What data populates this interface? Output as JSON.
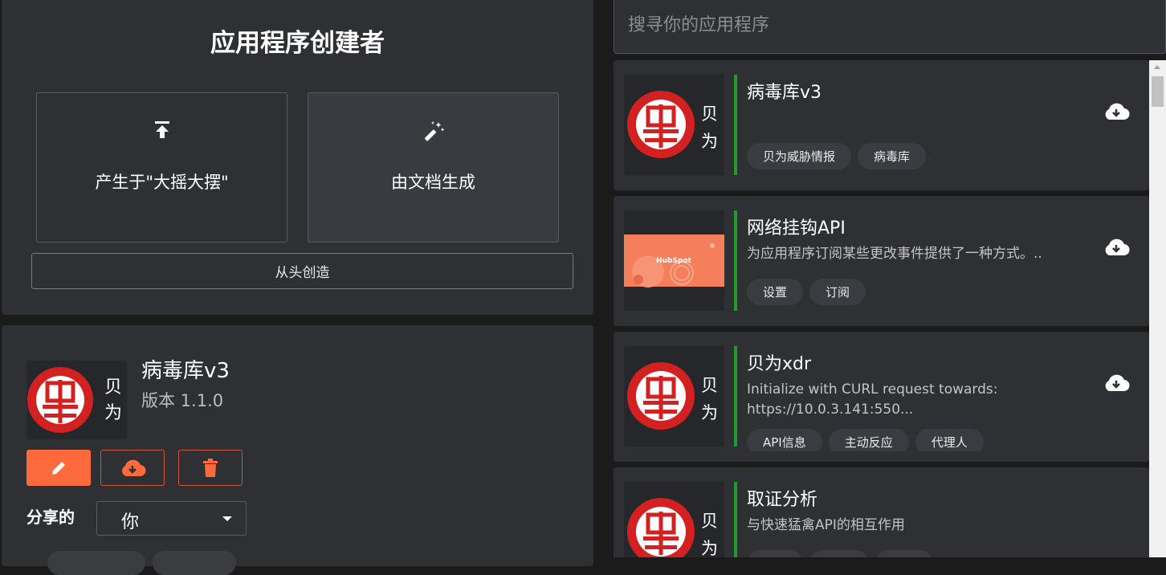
{
  "creator": {
    "title": "应用程序创建者",
    "options": [
      {
        "label": "产生于\"大摇大摆\"",
        "icon": "upload-icon"
      },
      {
        "label": "由文档生成",
        "icon": "magic-wand-icon"
      }
    ],
    "scratch_label": "从头创造"
  },
  "detail": {
    "app_name": "病毒库v3",
    "version": "版本 1.1.0",
    "share_label": "分享的",
    "share_value": "你",
    "actions": [
      "edit-icon",
      "download-icon",
      "delete-icon"
    ]
  },
  "search": {
    "placeholder": "搜寻你的应用程序"
  },
  "apps": [
    {
      "name": "病毒库v3",
      "description": "",
      "tags": [
        "贝为威胁情报",
        "病毒库"
      ],
      "logo": "huawei-logo"
    },
    {
      "name": "网络挂钩API",
      "description": "为应用程序订阅某些更改事件提供了一种方式。..",
      "tags": [
        "设置",
        "订阅"
      ],
      "logo": "hubspot-logo",
      "logo_text": "HubSpot"
    },
    {
      "name": "贝为xdr",
      "description": "Initialize with CURL request towards: https://10.0.3.141:550...",
      "tags": [
        "API信息",
        "主动反应",
        "代理人"
      ],
      "logo": "huawei-logo"
    },
    {
      "name": "取证分析",
      "description": "与快速猛禽API的相互作用",
      "tags": [],
      "logo": "huawei-logo"
    }
  ],
  "logo_text": "贝为",
  "colors": {
    "accent": "#ff6a3d",
    "panel": "#2f3034",
    "status_bar": "#1f9d2b",
    "logo_red": "#d32020"
  }
}
